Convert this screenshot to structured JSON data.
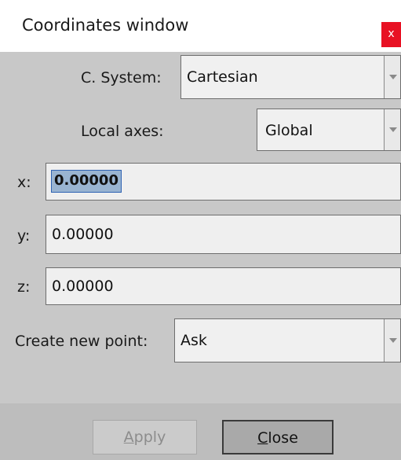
{
  "window": {
    "title": "Coordinates window",
    "close_label": "x"
  },
  "form": {
    "c_system": {
      "label": "C. System:",
      "value": "Cartesian"
    },
    "local_axes": {
      "label": "Local axes:",
      "value": "Global"
    },
    "x": {
      "label": "x:",
      "value": "0.00000"
    },
    "y": {
      "label": "y:",
      "value": "0.00000"
    },
    "z": {
      "label": "z:",
      "value": "0.00000"
    },
    "create_new_point": {
      "label": "Create new point:",
      "value": "Ask"
    }
  },
  "buttons": {
    "apply": {
      "label_mnemonic": "A",
      "label_rest": "pply",
      "enabled": false
    },
    "close": {
      "label_mnemonic": "C",
      "label_rest": "lose",
      "enabled": true
    }
  },
  "colors": {
    "panel_bg": "#c8c8c8",
    "close_red": "#e81123",
    "selection": "#99b4d1"
  }
}
